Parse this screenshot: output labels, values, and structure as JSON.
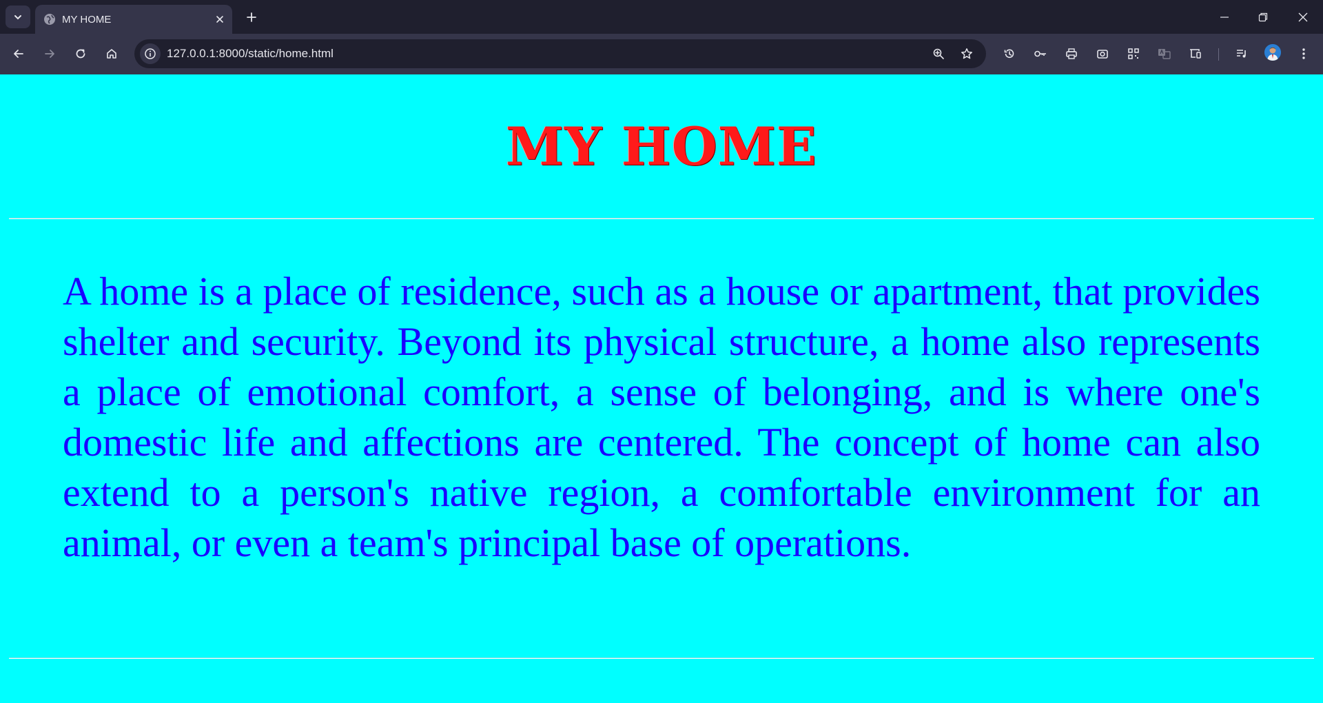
{
  "browser": {
    "tab_title": "MY HOME",
    "url": "127.0.0.1:8000/static/home.html"
  },
  "page": {
    "heading": "MY HOME",
    "paragraph": "A home is a place of residence, such as a house or apartment, that provides shelter and security. Beyond its physical structure, a home also represents a place of emotional comfort, a sense of belonging, and is where one's domestic life and affections are centered. The concept of home can also extend to a person's native region, a comfortable environment for an animal, or even a team's principal base of operations."
  },
  "colors": {
    "page_background": "#00ffff",
    "heading": "#ff1a1a",
    "paragraph": "#1a00ff",
    "chrome_dark": "#1f1f2e",
    "chrome_light": "#35354a"
  }
}
